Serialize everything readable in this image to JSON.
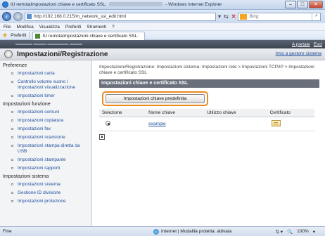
{
  "window": {
    "title": "IU remotaImpostazioni chiave e certificato SSL:",
    "title_suffix": "- Windows Internet Explorer",
    "btn_min": "–",
    "btn_max": "□",
    "btn_close": "✕"
  },
  "address": {
    "url": "http://192.168.0.215/m_network_ssl_edit.html",
    "search_placeholder": "Bing"
  },
  "menu": [
    "File",
    "Modifica",
    "Visualizza",
    "Preferiti",
    "Strumenti",
    "?"
  ],
  "favorites": {
    "label": "Preferiti",
    "tab_title": "IU remotaImpostazioni chiave e certificato SSL:"
  },
  "page": {
    "top_links": [
      "A portale",
      "Esci"
    ],
    "title": "Impostazioni/Registrazione",
    "admin_link": "Imio a gestore sistema",
    "breadcrumb": "Impostazioni/Registrazione: Impostazioni sistema: Impostazioni rete > Impostazioni TCP/IP > Impostazioni chiave e certificato SSL",
    "section_title": "Impostazioni chiave e certificato SSL",
    "default_button": "Impostazioni chiave predefinita",
    "table": {
      "headers": [
        "Selezione",
        "Nome chiave",
        "Utilizzo chiave",
        "Certificato"
      ],
      "rows": [
        {
          "key_name": "example",
          "usage": ""
        }
      ]
    }
  },
  "sidebar": {
    "sections": [
      {
        "title": "Preferenze",
        "items": [
          "Impostazioni carta",
          "Controllo volume suono / Impostazioni visualizzazione",
          "Impostazioni timer"
        ]
      },
      {
        "title": "Impostazioni funzione",
        "items": [
          "Impostazioni comuni",
          "Impostazioni copiatura",
          "Impostazioni fax",
          "Impostazioni scansione",
          "Impostazioni stampa diretta da USB",
          "Impostazioni stampante",
          "Impostazioni rapporti"
        ]
      },
      {
        "title": "Impostazioni sistema",
        "items": [
          "Impostazioni sistema",
          "Gestione ID divisione",
          "Impostazioni protezione"
        ]
      }
    ]
  },
  "status": {
    "left": "Fine",
    "zone": "Internet | Modalità protetta: attivata",
    "zoom": "100%"
  }
}
